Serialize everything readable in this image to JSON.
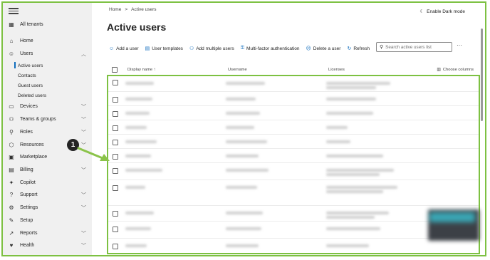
{
  "sidebar": {
    "tenant": "All tenants",
    "items": [
      {
        "label": "Home",
        "icon": "home-icon",
        "glyph": "⌂"
      },
      {
        "label": "Users",
        "icon": "user-icon",
        "glyph": "☺",
        "expanded": true
      },
      {
        "label": "Devices",
        "icon": "devices-icon",
        "glyph": "▭",
        "chevron": true
      },
      {
        "label": "Teams & groups",
        "icon": "teams-icon",
        "glyph": "⚇",
        "chevron": true
      },
      {
        "label": "Roles",
        "icon": "roles-icon",
        "glyph": "⚲",
        "chevron": true
      },
      {
        "label": "Resources",
        "icon": "resources-icon",
        "glyph": "⬡",
        "chevron": true
      },
      {
        "label": "Marketplace",
        "icon": "marketplace-icon",
        "glyph": "▣"
      },
      {
        "label": "Billing",
        "icon": "billing-icon",
        "glyph": "▤",
        "chevron": true
      },
      {
        "label": "Copilot",
        "icon": "copilot-icon",
        "glyph": "✦"
      },
      {
        "label": "Support",
        "icon": "support-icon",
        "glyph": "?",
        "chevron": true
      },
      {
        "label": "Settings",
        "icon": "gear-icon",
        "glyph": "⚙",
        "chevron": true
      },
      {
        "label": "Setup",
        "icon": "setup-icon",
        "glyph": "✎"
      },
      {
        "label": "Reports",
        "icon": "reports-icon",
        "glyph": "↗",
        "chevron": true
      },
      {
        "label": "Health",
        "icon": "health-icon",
        "glyph": "♥",
        "chevron": true
      }
    ],
    "users_sub": [
      "Active users",
      "Contacts",
      "Guest users",
      "Deleted users"
    ]
  },
  "breadcrumb": {
    "home": "Home",
    "sep": ">",
    "current": "Active users"
  },
  "dark_mode_label": "Enable Dark mode",
  "page_title": "Active users",
  "toolbar": [
    {
      "label": "Add a user",
      "icon": "add-user-icon",
      "glyph": "☺"
    },
    {
      "label": "User templates",
      "icon": "template-icon",
      "glyph": "▤"
    },
    {
      "label": "Add multiple users",
      "icon": "multi-user-icon",
      "glyph": "⚇"
    },
    {
      "label": "Multi-factor authentication",
      "icon": "lock-icon",
      "glyph": "⚿"
    },
    {
      "label": "Delete a user",
      "icon": "delete-user-icon",
      "glyph": "☹"
    },
    {
      "label": "Refresh",
      "icon": "refresh-icon",
      "glyph": "↻"
    }
  ],
  "search": {
    "placeholder": "Search active users list"
  },
  "more_glyph": "···",
  "table": {
    "columns": {
      "display_name": "Display name",
      "sort": "↑",
      "username": "Username",
      "licenses": "Licenses",
      "choose": "Choose columns"
    }
  },
  "callout": {
    "number": "1"
  }
}
